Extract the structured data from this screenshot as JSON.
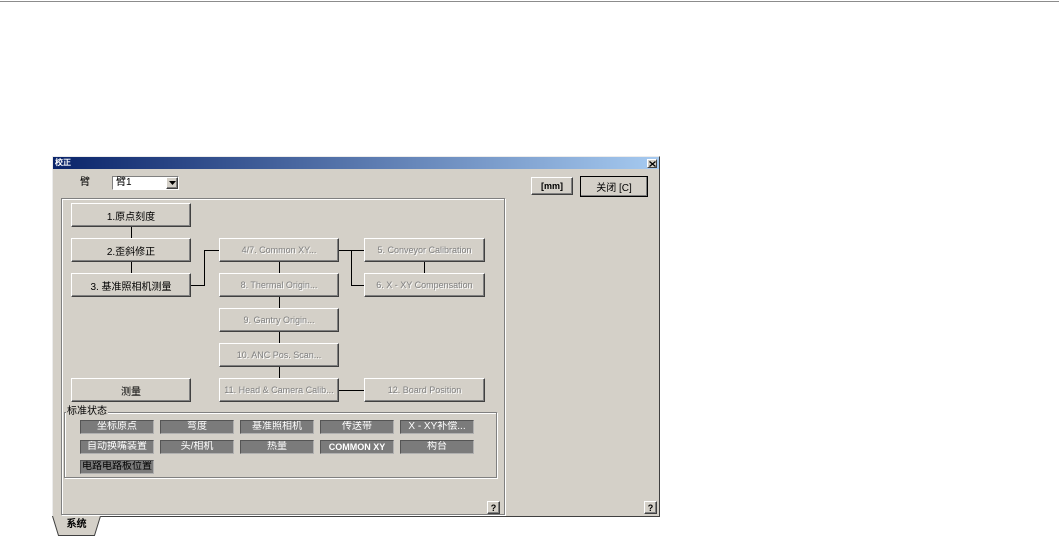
{
  "window": {
    "title": "校正",
    "close_icon": "close-icon"
  },
  "toolbar": {
    "arm_label": "臂",
    "arm_select": {
      "value": "臂1",
      "icon": "dropdown-arrow-icon"
    },
    "unit_button": "[mm]",
    "close_button": "关闭 [C]"
  },
  "flow": {
    "origin_calib": {
      "label": "1.原点刻度",
      "enabled": true
    },
    "skew_correction": {
      "label": "2.歪斜修正",
      "enabled": true
    },
    "fiducial_camera": {
      "label": "3. 基准照相机测量",
      "enabled": true
    },
    "common_xy": {
      "label": "4/7. Common XY...",
      "enabled": false
    },
    "conveyor_calibration": {
      "label": "5. Conveyor Calibration",
      "enabled": false
    },
    "x_xy_compensation": {
      "label": "6. X - XY Compensation",
      "enabled": false
    },
    "thermal_origin": {
      "label": "8. Thermal Origin...",
      "enabled": false
    },
    "gantry_origin": {
      "label": "9. Gantry Origin...",
      "enabled": false
    },
    "anc_pos_scan": {
      "label": "10. ANC Pos. Scan...",
      "enabled": false
    },
    "head_camera_calib": {
      "label": "11. Head & Camera Calib...",
      "enabled": false
    },
    "board_position": {
      "label": "12. Board Position",
      "enabled": false
    },
    "measure": {
      "label": "测量",
      "enabled": true
    }
  },
  "status": {
    "title": "标准状态",
    "rows": [
      [
        "坐标原点",
        "弯度",
        "基准照相机",
        "传送带",
        "X - XY补偿..."
      ],
      [
        "自动换嘴装置",
        "头/相机",
        "热量",
        "COMMON XY",
        "构台"
      ],
      [
        "电路电路板位置"
      ]
    ]
  },
  "help_label": "?",
  "tabs": [
    {
      "label": "系统",
      "active": true
    }
  ],
  "colors": {
    "face": "#d4d0c8",
    "title_start": "#0a246a",
    "title_end": "#a6caf0",
    "status_fill": "#7b7b7b",
    "disabled_text": "#808080"
  }
}
